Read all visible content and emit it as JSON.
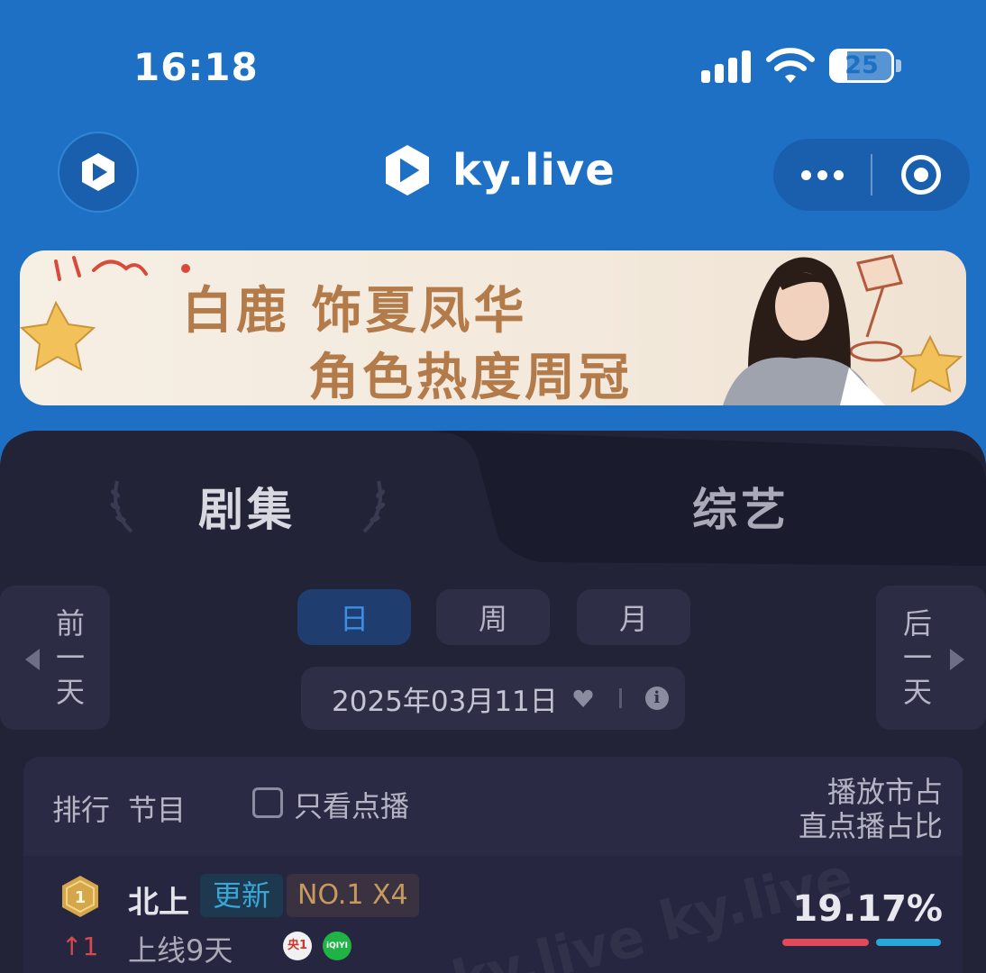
{
  "status_bar": {
    "time": "16:18",
    "battery_level": "25",
    "battery_fraction": 0.25,
    "icons": [
      "signal-icon",
      "wifi-icon",
      "battery-icon"
    ]
  },
  "nav": {
    "brand_name": "ky.live",
    "brand_color": "#1e70c4",
    "icons": [
      "app-logo-icon",
      "more-dots-icon",
      "close-target-icon"
    ]
  },
  "banner": {
    "line1": "白鹿 饰夏凤华",
    "line2": "角色热度周冠"
  },
  "tabs": {
    "drama": "剧集",
    "variety": "综艺",
    "active": "drama"
  },
  "date_nav": {
    "prev_label": "前一天",
    "next_label": "后一天",
    "periods": [
      "日",
      "周",
      "月"
    ],
    "active_period": "日",
    "date": "2025年03月11日"
  },
  "table": {
    "headers": {
      "rank": "排行",
      "show": "节目",
      "vod_only": "只看点播",
      "share_line1": "播放市占",
      "share_line2": "直点播占比"
    },
    "rows": [
      {
        "rank": "1",
        "rank_change": "1",
        "title": "北上",
        "tag_update": "更新",
        "tag_rank": "NO.1 X4",
        "online_days": "上线9天",
        "platforms": [
          {
            "name": "cctv1-icon",
            "label": "央1",
            "color": "#d4322c"
          },
          {
            "name": "iqiyi-icon",
            "label": "iQIYI",
            "color": "#21b246"
          }
        ],
        "share": "19.17%"
      }
    ]
  },
  "watermark": "ky.live",
  "colors": {
    "panel": "#232338",
    "active_period": "#3d8ee6",
    "update_tag": "#39a7d6",
    "rank_tag": "#c69a5e",
    "rank_up": "#d54a4a"
  }
}
